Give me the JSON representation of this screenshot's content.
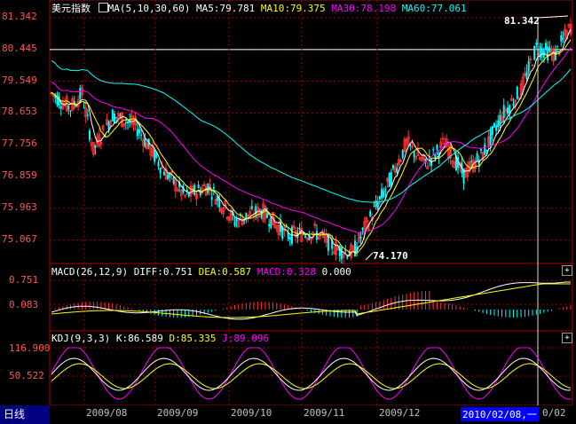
{
  "main_panel": {
    "title": "美元指数",
    "ma_params": "MA(5,10,30,60)",
    "ma5": "MA5:79.781",
    "ma10": "MA10:79.375",
    "ma30": "MA30:78.198",
    "ma60": "MA60:77.061",
    "y_ticks": [
      "81.342",
      "80.445",
      "79.549",
      "78.653",
      "77.756",
      "76.859",
      "75.963",
      "75.067"
    ],
    "high_label": "81.342",
    "low_label": "74.170"
  },
  "macd_panel": {
    "title": "MACD(26,12,9)",
    "diff": "DIFF:0.751",
    "dea": "DEA:0.587",
    "macd": "MACD:0.328",
    "extra": "0.000",
    "y_ticks": [
      "0.751",
      "0.083"
    ]
  },
  "kdj_panel": {
    "title": "KDJ(9,3,3)",
    "k": "K:86.589",
    "d": "D:85.335",
    "j": "J:89.096",
    "y_ticks": [
      "116.900",
      "50.522"
    ]
  },
  "bottom_bar": {
    "tab_label": "日线",
    "months": [
      "2009/08",
      "2009/09",
      "2009/10",
      "2009/11",
      "2009/12"
    ],
    "cursor_date": "2010/02/08,一",
    "cursor_tail": "0/02"
  },
  "colors": {
    "up": "#ff3333",
    "down": "#00ffff",
    "ma5": "#ffffff",
    "ma10": "#ffff00",
    "ma30": "#ff00ff",
    "ma60": "#00ffff",
    "grid": "#aa0000"
  }
}
